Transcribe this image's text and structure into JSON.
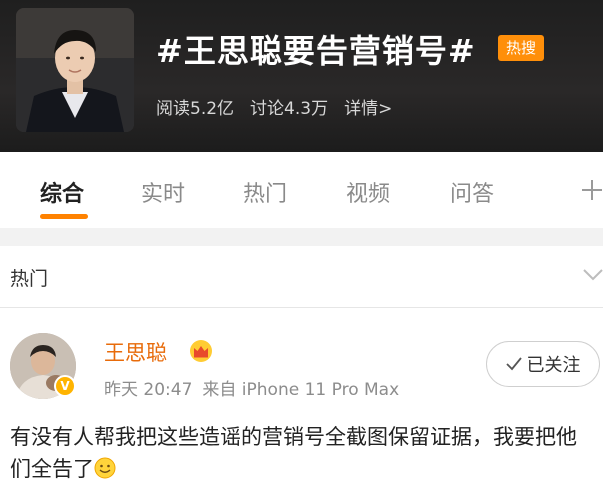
{
  "topic": {
    "title": "#王思聪要告营销号#",
    "badge": "热搜",
    "stats": {
      "reads": "阅读5.2亿",
      "discussions": "讨论4.3万",
      "details": "详情>"
    }
  },
  "tabs": [
    {
      "label": "综合",
      "active": true
    },
    {
      "label": "实时",
      "active": false
    },
    {
      "label": "热门",
      "active": false
    },
    {
      "label": "视频",
      "active": false
    },
    {
      "label": "问答",
      "active": false
    }
  ],
  "section": {
    "title": "热门"
  },
  "post": {
    "author": "王思聪",
    "time": "昨天 20:47",
    "source": "来自 iPhone 11 Pro Max",
    "follow_label": "已关注",
    "text": "有没有人帮我把这些造谣的营销号全截图保留证据，我要把他们全告了"
  },
  "colors": {
    "accent": "#ff8200",
    "badge": "#ff8f0a",
    "author": "#e86b0a",
    "header_bg": "#1f1f1f"
  },
  "icons": [
    "add-icon",
    "chevron-down-icon",
    "crown-icon",
    "checkmark-icon",
    "smile-emoji-icon",
    "verified-icon"
  ]
}
